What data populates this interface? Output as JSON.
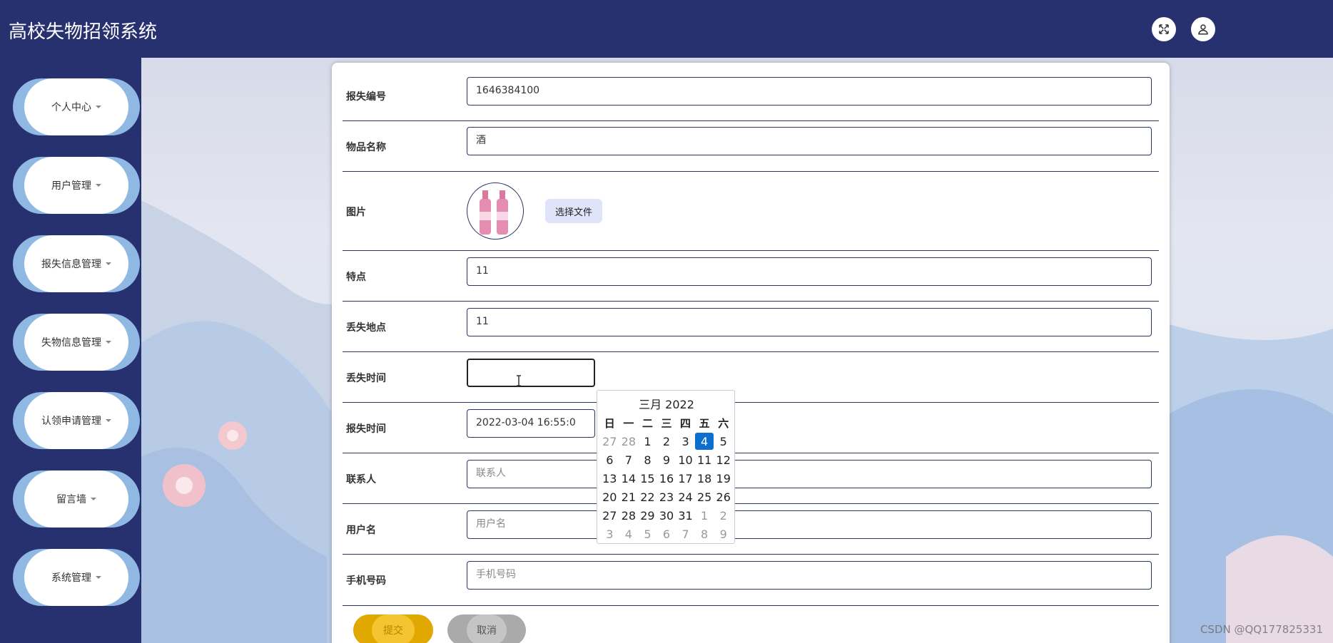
{
  "header": {
    "title": "高校失物招领系统",
    "fullscreen_icon": "expand-icon",
    "user_icon": "user-icon"
  },
  "sidebar": {
    "items": [
      {
        "label": "个人中心"
      },
      {
        "label": "用户管理"
      },
      {
        "label": "报失信息管理"
      },
      {
        "label": "失物信息管理"
      },
      {
        "label": "认领申请管理"
      },
      {
        "label": "留言墙"
      },
      {
        "label": "系统管理"
      }
    ]
  },
  "form": {
    "report_no": {
      "label": "报失编号",
      "value": "1646384100"
    },
    "item_name": {
      "label": "物品名称",
      "value": "酒"
    },
    "image": {
      "label": "图片",
      "button": "选择文件"
    },
    "features": {
      "label": "特点",
      "value": "11"
    },
    "lost_place": {
      "label": "丢失地点",
      "value": "11"
    },
    "lost_time": {
      "label": "丢失时间",
      "value": ""
    },
    "report_time": {
      "label": "报失时间",
      "value": "2022-03-04 16:55:0"
    },
    "contact": {
      "label": "联系人",
      "placeholder": "联系人"
    },
    "username": {
      "label": "用户名",
      "placeholder": "用户名"
    },
    "phone": {
      "label": "手机号码",
      "placeholder": "手机号码"
    },
    "submit_label": "提交",
    "cancel_label": "取消"
  },
  "datepicker": {
    "title": "三月 2022",
    "weekdays": [
      "日",
      "一",
      "二",
      "三",
      "四",
      "五",
      "六"
    ],
    "weeks": [
      [
        {
          "d": "27",
          "m": true
        },
        {
          "d": "28",
          "m": true
        },
        {
          "d": "1"
        },
        {
          "d": "2"
        },
        {
          "d": "3"
        },
        {
          "d": "4",
          "sel": true
        },
        {
          "d": "5"
        }
      ],
      [
        {
          "d": "6"
        },
        {
          "d": "7"
        },
        {
          "d": "8"
        },
        {
          "d": "9"
        },
        {
          "d": "10"
        },
        {
          "d": "11"
        },
        {
          "d": "12"
        }
      ],
      [
        {
          "d": "13"
        },
        {
          "d": "14"
        },
        {
          "d": "15"
        },
        {
          "d": "16"
        },
        {
          "d": "17"
        },
        {
          "d": "18"
        },
        {
          "d": "19"
        }
      ],
      [
        {
          "d": "20"
        },
        {
          "d": "21"
        },
        {
          "d": "22"
        },
        {
          "d": "23"
        },
        {
          "d": "24"
        },
        {
          "d": "25"
        },
        {
          "d": "26"
        }
      ],
      [
        {
          "d": "27"
        },
        {
          "d": "28"
        },
        {
          "d": "29"
        },
        {
          "d": "30"
        },
        {
          "d": "31"
        },
        {
          "d": "1",
          "m": true
        },
        {
          "d": "2",
          "m": true
        }
      ],
      [
        {
          "d": "3",
          "m": true
        },
        {
          "d": "4",
          "m": true
        },
        {
          "d": "5",
          "m": true
        },
        {
          "d": "6",
          "m": true
        },
        {
          "d": "7",
          "m": true
        },
        {
          "d": "8",
          "m": true
        },
        {
          "d": "9",
          "m": true
        }
      ]
    ]
  },
  "watermark": "CSDN @QQ177825331",
  "colors": {
    "header_bg": "#283170",
    "accent_submit": "#f4c431",
    "selected_day": "#0d6ed0"
  }
}
